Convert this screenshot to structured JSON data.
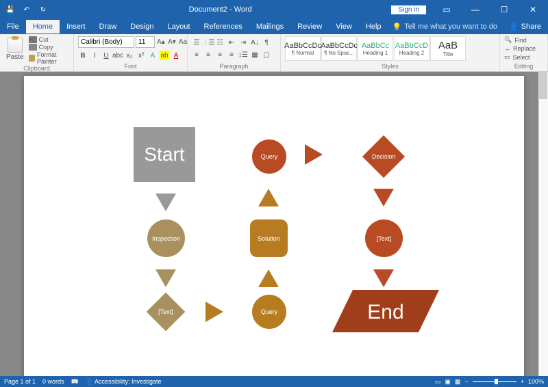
{
  "title": {
    "doc": "Document2",
    "app": "Word"
  },
  "titlebar": {
    "signin": "Sign in"
  },
  "menu": {
    "file": "File",
    "home": "Home",
    "insert": "Insert",
    "draw": "Draw",
    "design": "Design",
    "layout": "Layout",
    "references": "References",
    "mailings": "Mailings",
    "review": "Review",
    "view": "View",
    "help": "Help",
    "tellme": "Tell me what you want to do",
    "share": "Share"
  },
  "ribbon": {
    "clipboard": {
      "label": "Clipboard",
      "paste": "Paste",
      "cut": "Cut",
      "copy": "Copy",
      "format_painter": "Format Painter"
    },
    "font": {
      "label": "Font",
      "name": "Calibri (Body)",
      "size": "11"
    },
    "paragraph": {
      "label": "Paragraph"
    },
    "styles": {
      "label": "Styles",
      "items": [
        {
          "preview": "AaBbCcDc",
          "name": "¶ Normal"
        },
        {
          "preview": "AaBbCcDc",
          "name": "¶ No Spac..."
        },
        {
          "preview": "AaBbCc",
          "name": "Heading 1"
        },
        {
          "preview": "AaBbCcD",
          "name": "Heading 2"
        },
        {
          "preview": "AaB",
          "name": "Title"
        }
      ]
    },
    "editing": {
      "label": "Editing",
      "find": "Find",
      "replace": "Replace",
      "select": "Select"
    }
  },
  "flow": {
    "start": "Start",
    "query": "Query",
    "decision": "Decision",
    "inspection": "Inspection",
    "solution": "Solution",
    "text": "[Text]",
    "query2": "Query",
    "end": "End"
  },
  "status": {
    "page": "Page 1 of 1",
    "words": "0 words",
    "accessibility": "Accessibility: Investigate",
    "zoom": "100%"
  },
  "colors": {
    "gray": "#999999",
    "tan": "#a8915f",
    "ochre": "#b87c20",
    "rust": "#b84b24",
    "darkrust": "#a03e1c"
  }
}
